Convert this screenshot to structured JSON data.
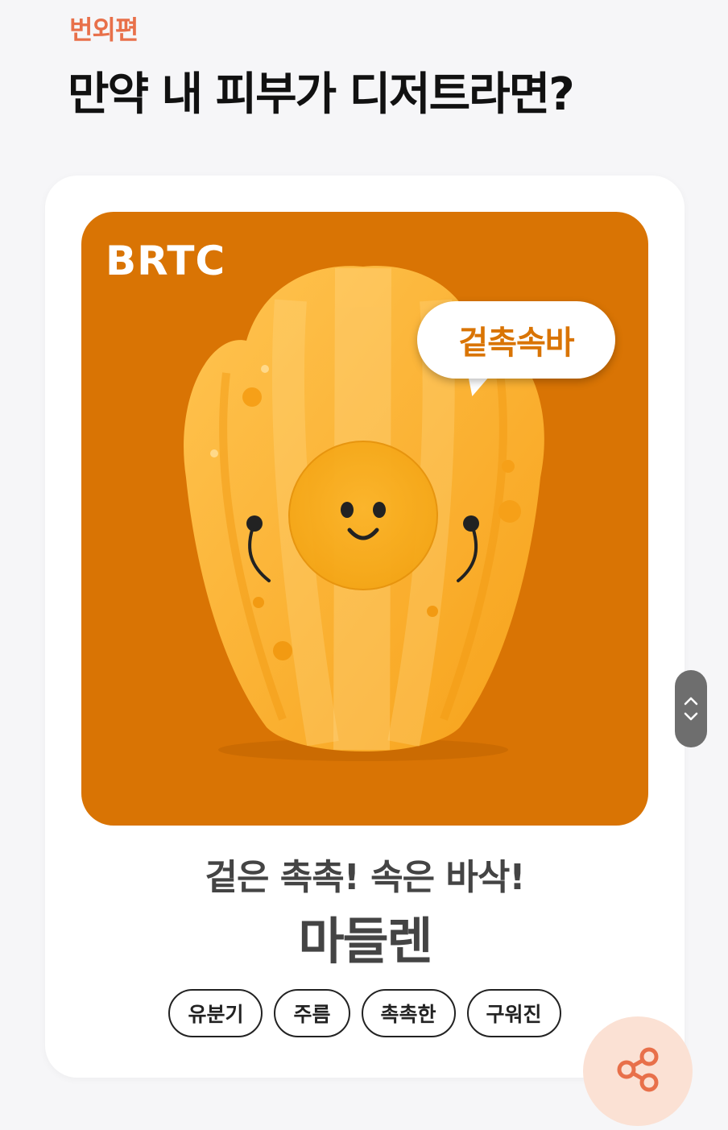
{
  "header": {
    "eyebrow": "번외편",
    "title": "만약 내 피부가 디저트라면?"
  },
  "card": {
    "brand": "BRTC",
    "speech_bubble": "겉촉속바",
    "tagline": "겉은 촉촉! 속은 바삭!",
    "dessert_name": "마들렌",
    "tags": [
      "유분기",
      "주름",
      "촉촉한",
      "구워진"
    ]
  },
  "colors": {
    "accent": "#e8704a",
    "art_background": "#d97404",
    "share_button_bg": "#fbe1d4"
  },
  "icons": {
    "scroll_up": "chevron-up-icon",
    "scroll_down": "chevron-down-icon",
    "share": "share-icon"
  }
}
